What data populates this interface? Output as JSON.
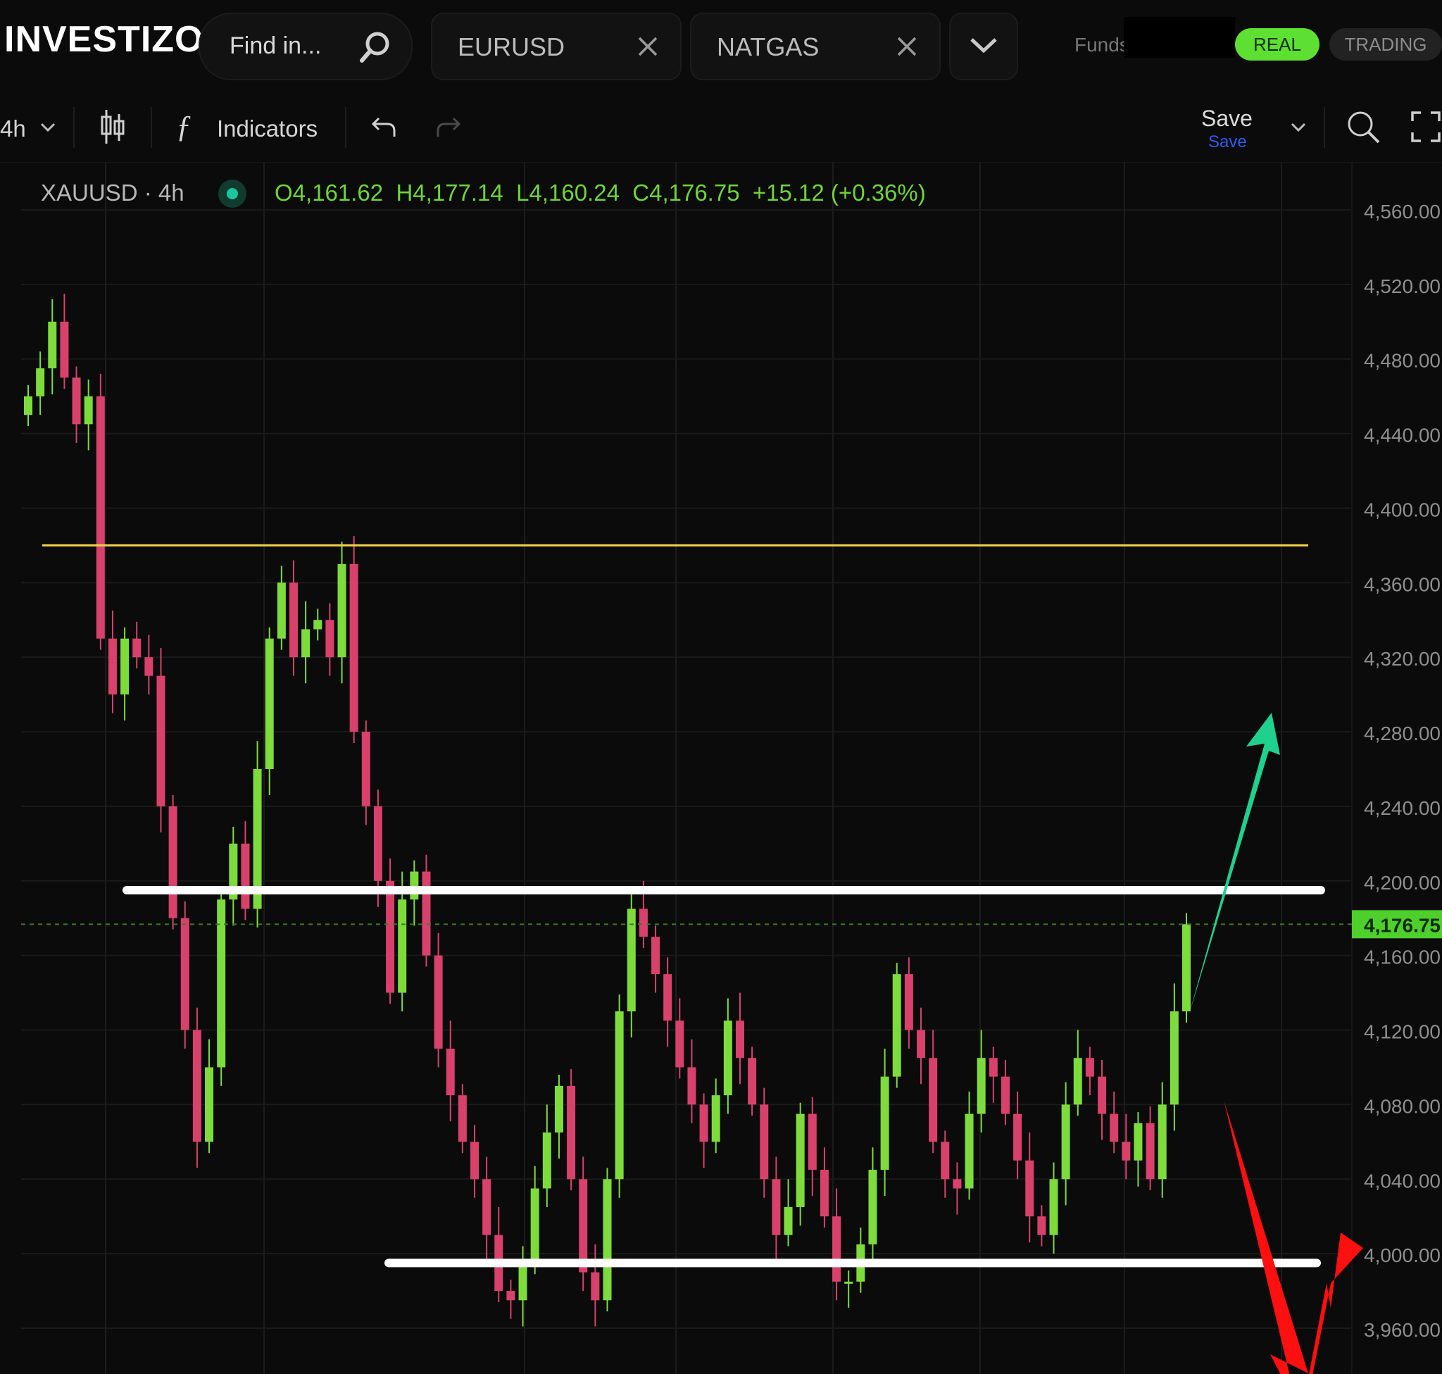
{
  "app": {
    "logo_text": "INVESTIZO"
  },
  "search": {
    "placeholder": "Find in..."
  },
  "tabs": [
    {
      "label": "EURUSD"
    },
    {
      "label": "NATGAS"
    }
  ],
  "account": {
    "funds_label": "Funds",
    "real_label": "REAL",
    "trading_label": "TRADING"
  },
  "toolbar": {
    "timeframe": "4h",
    "indicators_label": "Indicators",
    "save_label": "Save",
    "save_sub_label": "Save"
  },
  "symbol": {
    "title": "XAUUSD · 4h",
    "open": "O4,161.62",
    "high": "H4,177.14",
    "low": "L4,160.24",
    "close": "C4,176.75",
    "change": "+15.12 (+0.36%)"
  },
  "colors": {
    "bull": "#7ddc3c",
    "bear": "#d9416d",
    "resistance_line": "#f2d34b",
    "white_levels": "#ffffff",
    "arrow_up": "#20d08f",
    "arrow_red": "#ff1010",
    "price_tag_bg": "#4fcf2b"
  },
  "chart_data": {
    "type": "line",
    "title": "",
    "xlabel": "",
    "ylabel": "",
    "ylim": [
      3940,
      4580
    ],
    "y_ticks": [
      "4,560.00",
      "4,520.00",
      "4,480.00",
      "4,440.00",
      "4,400.00",
      "4,360.00",
      "4,320.00",
      "4,280.00",
      "4,240.00",
      "4,200.00",
      "4,160.00",
      "4,120.00",
      "4,080.00",
      "4,040.00",
      "4,000.00",
      "3,960.00"
    ],
    "current_price": 4176.75,
    "current_price_label": "4,176.75",
    "series": [
      {
        "values": [
          4460,
          4475,
          4500,
          4470,
          4445,
          4460,
          4330,
          4300,
          4330,
          4320,
          4310,
          4240,
          4180,
          4120,
          4060,
          4100,
          4190,
          4220,
          4185,
          4260,
          4330,
          4360,
          4320,
          4335,
          4340,
          4320,
          4370,
          4280,
          4240,
          4200,
          4140,
          4190,
          4205,
          4160,
          4110,
          4085,
          4060,
          4040,
          4010,
          3980,
          3975,
          3995,
          4035,
          4065,
          4090,
          4040,
          3990,
          3975,
          4040,
          4130,
          4185,
          4170,
          4150,
          4125,
          4100,
          4080,
          4060,
          4085,
          4125,
          4105,
          4080,
          4040,
          4010,
          4025,
          4075,
          4045,
          4020,
          3985,
          3985,
          4005,
          4045,
          4095,
          4150,
          4120,
          4105,
          4060,
          4040,
          4035,
          4075,
          4105,
          4095,
          4075,
          4050,
          4020,
          4010,
          4040,
          4080,
          4105,
          4095,
          4075,
          4060,
          4050,
          4070,
          4040,
          4080,
          4130,
          4176.75
        ]
      }
    ],
    "annotations": {
      "resistance_level": 4380,
      "range_top": 4195,
      "range_bottom": 3995
    }
  }
}
